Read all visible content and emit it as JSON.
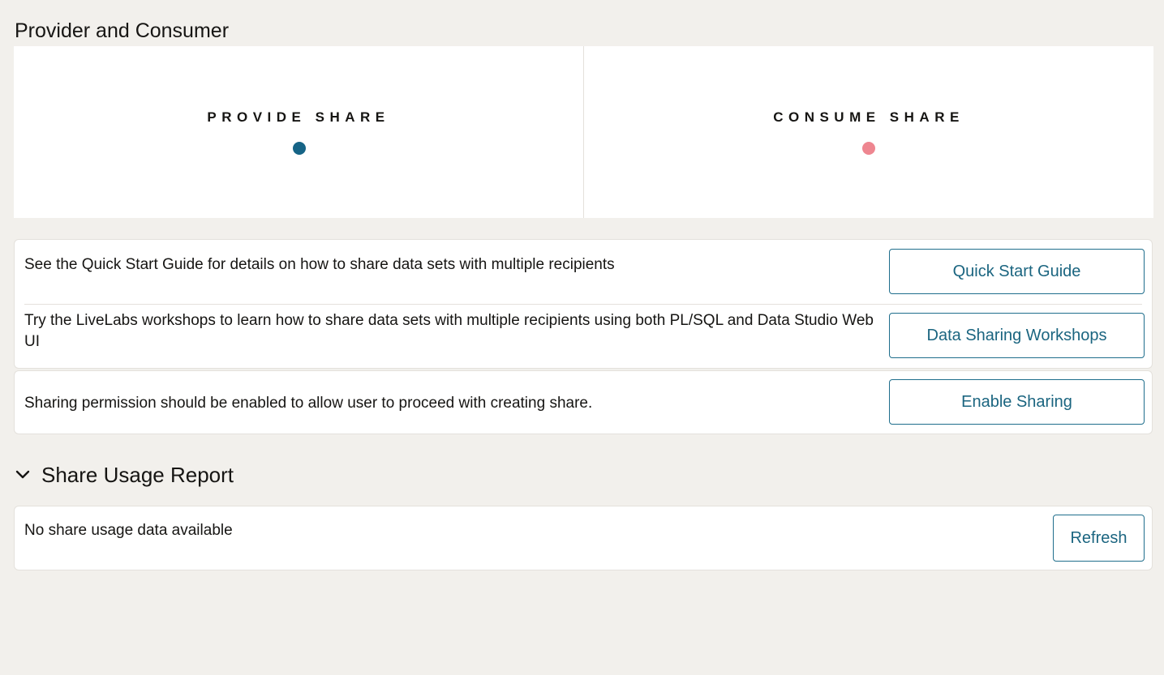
{
  "provider_consumer": {
    "title": "Provider and Consumer",
    "provide": {
      "label": "PROVIDE SHARE",
      "dot_color": "#166486"
    },
    "consume": {
      "label": "CONSUME SHARE",
      "dot_color": "#ee8690"
    }
  },
  "info_card": {
    "rows": [
      {
        "text": "See the Quick Start Guide for details on how to share data sets with multiple recipients",
        "button_label": "Quick Start Guide"
      },
      {
        "text": "Try the LiveLabs workshops to learn how to share data sets with multiple recipients using both PL/SQL and Data Studio Web UI",
        "button_label": "Data Sharing Workshops"
      }
    ]
  },
  "permission_card": {
    "text": "Sharing permission should be enabled to allow user to proceed with creating share.",
    "button_label": "Enable Sharing"
  },
  "usage_report": {
    "title": "Share Usage Report",
    "expanded": true,
    "chevron_icon": "chevron-down-icon",
    "empty_text": "No share usage data available",
    "refresh_label": "Refresh"
  },
  "colors": {
    "accent": "#1b6580",
    "background": "#f2f0ec",
    "surface": "#ffffff",
    "border": "#e4e1dc"
  }
}
